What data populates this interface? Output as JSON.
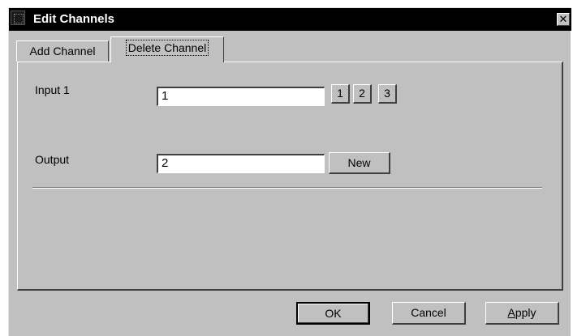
{
  "window": {
    "title": "Edit Channels",
    "close_glyph": "✕"
  },
  "tabs": [
    {
      "label": "Add Channel",
      "selected": false
    },
    {
      "label": "Delete Channel",
      "selected": true
    }
  ],
  "form": {
    "input1": {
      "label": "Input 1",
      "value": "1",
      "buttons": [
        "1",
        "2",
        "3"
      ]
    },
    "output": {
      "label": "Output",
      "value": "2",
      "button_label": "New"
    }
  },
  "footer": {
    "ok_label": "OK",
    "cancel_label": "Cancel",
    "apply_first": "A",
    "apply_rest": "pply"
  },
  "colors": {
    "face": "#c0c0c0",
    "titlebar": "#000000"
  }
}
